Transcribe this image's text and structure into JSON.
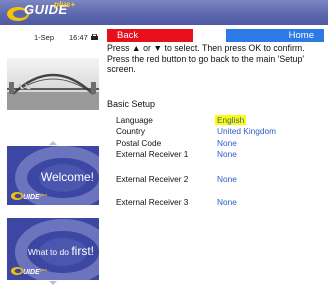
{
  "header": {
    "logo_text": "GUIDE",
    "logo_plus": "plus+"
  },
  "status": {
    "date": "1-Sep",
    "time": "16:47"
  },
  "sidebar": {
    "panels": [
      {
        "title": "Welcome!"
      },
      {
        "title_prefix": "What to do ",
        "title_main": "first!"
      }
    ],
    "mini_logo_text": "GUIDE plus+"
  },
  "buttons": {
    "back": "Back",
    "home": "Home"
  },
  "instructions": "Press ▲ or ▼ to select.  Then press OK to confirm. Press the red button to go back to the main 'Setup' screen.",
  "section_title": "Basic Setup",
  "settings": [
    {
      "label": "Language",
      "value": "English"
    },
    {
      "label": "Country",
      "value": "United Kingdom"
    },
    {
      "label": "Postal Code",
      "value": "None"
    },
    {
      "label": "External Receiver 1",
      "value": "None"
    },
    {
      "label": "External Receiver 2",
      "value": "None"
    },
    {
      "label": "External Receiver 3",
      "value": "None"
    }
  ],
  "colors": {
    "header": "#5b66ad",
    "back": "#e80f1c",
    "home": "#2b7ae6",
    "highlight": "#ffff00",
    "value": "#2c5dcc"
  },
  "icons": [
    "lock-icon",
    "scroll-up-icon",
    "scroll-down-icon"
  ]
}
